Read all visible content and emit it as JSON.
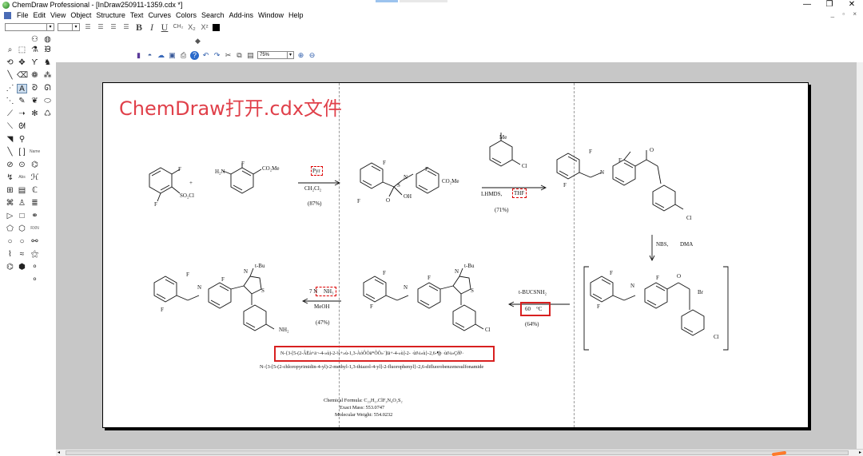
{
  "window": {
    "title": "ChemDraw Professional - [InDraw250911-1359.cdx *]",
    "controls": [
      "—",
      "❐",
      "✕"
    ]
  },
  "menubar": {
    "items": [
      "File",
      "Edit",
      "View",
      "Object",
      "Structure",
      "Text",
      "Curves",
      "Colors",
      "Search",
      "Add-ins",
      "Window",
      "Help"
    ],
    "mdi_controls": "_ ▫ ×"
  },
  "format_toolbar": {
    "font_value": "",
    "size_value": "",
    "chem_label": "CH₂",
    "sub_label": "X₂",
    "sup_label": "X²",
    "bold": "B",
    "italic": "I",
    "underline": "U"
  },
  "std_toolbar": {
    "zoom_value": "75%"
  },
  "tool_palette": {
    "name_label": "Name",
    "abs_label": "Abs",
    "rxn_label": "RXN"
  },
  "document": {
    "overlay_title": "ChemDraw打开.cdx文件",
    "step1": {
      "reagent": "Pyr",
      "solvent": "CH₂Cl₂",
      "yield": "(87%)"
    },
    "step2": {
      "reagent_a": "LHMDS,",
      "reagent_b": "THF",
      "yield": "(71%)"
    },
    "step3": {
      "reagent_a": "NBS,",
      "reagent_b": "DMA"
    },
    "step4": {
      "reagent": "t-BUCSNH₂",
      "temp": "60",
      "temp_unit": "°C",
      "yield": "(64%)"
    },
    "step5": {
      "reagent": "NH₃",
      "prefix": "7 N",
      "solvent": "MeOH",
      "yield": "(47%)"
    },
    "labels": {
      "tbu": "t-Bu",
      "methyl": "Me",
      "co2me": "CO₂Me",
      "so2cl": "SO₂Cl",
      "h2n": "H₂N",
      "nh2": "NH₂",
      "f": "F",
      "n": "N",
      "s": "S",
      "o": "O",
      "br": "Br",
      "cl": "Cl",
      "nh": "N",
      "h": "H",
      "oh": "OH",
      "plus": "+"
    },
    "garbled_name": "N-{3-[5-(2-ÂËà+ä¬-4-»ù)-2-¼+»ù-1,3-ÀóÔÒä*ÔÕ»¨]ïä+-4-»ù]-2- ·ùï¼»ù}-2,6-¶þ ·ùï¼»Çðî¹·",
    "iupac_name": "N-{3-[5-(2-chloropyrimidin-4-yl)-2-methyl-1,3-thiazol-4-yl]-2-fluorophenyl}-2,6-difluorobenzenesulfonamide",
    "formula": "Chemical Formula: C₂₃H₁₇ClF₃N₄O₂S₂",
    "exact_mass": "Exact Mass: 553.0747",
    "mol_weight": "Molecular Weight: 554.0232"
  }
}
